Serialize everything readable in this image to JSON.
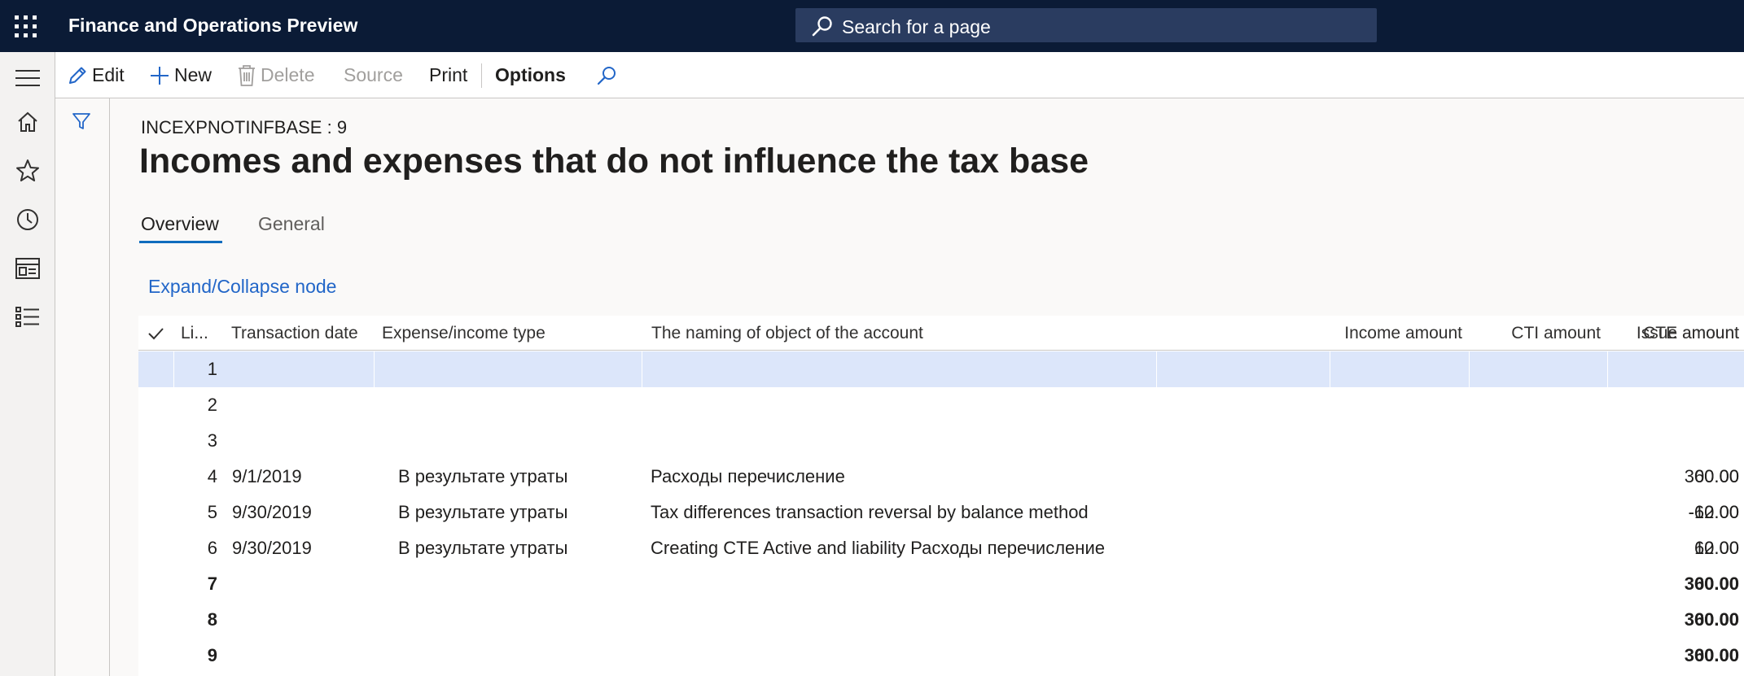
{
  "app": {
    "title": "Finance and Operations Preview",
    "search_placeholder": "Search for a page"
  },
  "toolbar": {
    "edit": "Edit",
    "new": "New",
    "delete": "Delete",
    "source": "Source",
    "print": "Print",
    "options": "Options"
  },
  "nav": {
    "icons": [
      "menu-icon",
      "home-icon",
      "star-icon",
      "clock-icon",
      "workspace-icon",
      "list-icon"
    ]
  },
  "page": {
    "record_id": "INCEXPNOTINFBASE : 9",
    "title": "Incomes and expenses that do not influence the tax base",
    "tabs": [
      {
        "label": "Overview",
        "active": true
      },
      {
        "label": "General",
        "active": false
      }
    ],
    "expand_link": "Expand/Collapse node"
  },
  "grid": {
    "columns": [
      "Li...",
      "Transaction date",
      "Expense/income type",
      "The naming of object of the account",
      "Income amount",
      "CTI amount",
      "Issue amount",
      "CTE amount"
    ],
    "rows": [
      {
        "line": "1",
        "date": "",
        "type": "",
        "name": "",
        "income": "",
        "cti": "",
        "issue": "",
        "cte": "",
        "selected": true,
        "bold": false
      },
      {
        "line": "2",
        "date": "",
        "type": "",
        "name": "",
        "income": "",
        "cti": "",
        "issue": "",
        "cte": "",
        "selected": false,
        "bold": false
      },
      {
        "line": "3",
        "date": "",
        "type": "",
        "name": "",
        "income": "",
        "cti": "",
        "issue": "",
        "cte": "",
        "selected": false,
        "bold": false
      },
      {
        "line": "4",
        "date": "9/1/2019",
        "type": "В результате утраты",
        "name": "Расходы перечисление",
        "income": "",
        "cti": "",
        "issue": "300.00",
        "cte": "60.00",
        "selected": false,
        "bold": false
      },
      {
        "line": "5",
        "date": "9/30/2019",
        "type": "В результате утраты",
        "name": "Tax differences transaction reversal by balance method",
        "income": "",
        "cti": "",
        "issue": "-60.00",
        "cte": "-12.00",
        "selected": false,
        "bold": false
      },
      {
        "line": "6",
        "date": "9/30/2019",
        "type": "В результате утраты",
        "name": "Creating CTE Active and liability Расходы перечисление",
        "income": "",
        "cti": "",
        "issue": "60.00",
        "cte": "12.00",
        "selected": false,
        "bold": false
      },
      {
        "line": "7",
        "date": "",
        "type": "",
        "name": "",
        "income": "",
        "cti": "",
        "issue": "300.00",
        "cte": "60.00",
        "selected": false,
        "bold": true
      },
      {
        "line": "8",
        "date": "",
        "type": "",
        "name": "",
        "income": "",
        "cti": "",
        "issue": "300.00",
        "cte": "60.00",
        "selected": false,
        "bold": true
      },
      {
        "line": "9",
        "date": "",
        "type": "",
        "name": "",
        "income": "",
        "cti": "",
        "issue": "300.00",
        "cte": "60.00",
        "selected": false,
        "bold": true
      }
    ]
  },
  "colors": {
    "topbar": "#0b1b36",
    "accent": "#0f6cbd",
    "link": "#2266c8",
    "selected_row": "#dce6fa"
  }
}
